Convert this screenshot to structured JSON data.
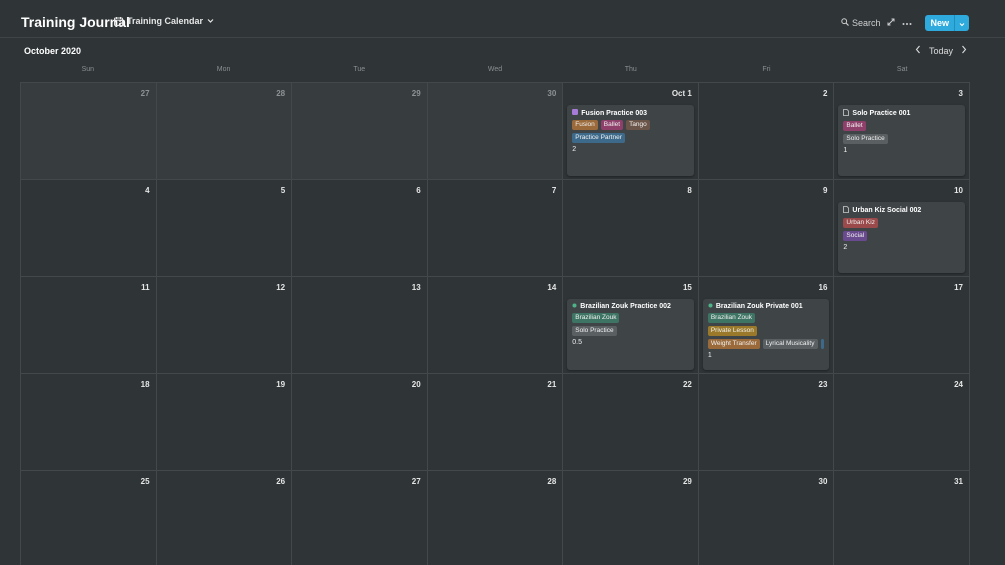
{
  "header": {
    "title": "Training Journal",
    "view_name": "Training Calendar",
    "search_label": "Search",
    "new_label": "New"
  },
  "calendar": {
    "month_label": "October 2020",
    "today_label": "Today",
    "weekdays": [
      "Sun",
      "Mon",
      "Tue",
      "Wed",
      "Thu",
      "Fri",
      "Sat"
    ],
    "weeks": [
      [
        "27",
        "28",
        "29",
        "30",
        "Oct 1",
        "2",
        "3"
      ],
      [
        "4",
        "5",
        "6",
        "7",
        "8",
        "9",
        "10"
      ],
      [
        "11",
        "12",
        "13",
        "14",
        "15",
        "16",
        "17"
      ],
      [
        "18",
        "19",
        "20",
        "21",
        "22",
        "23",
        "24"
      ],
      [
        "25",
        "26",
        "27",
        "28",
        "29",
        "30",
        "31"
      ]
    ]
  },
  "colors": {
    "accent": "#2eaadc",
    "background": "#2f3437",
    "tag_orange": "#9a6a3a",
    "tag_pink": "#8e3f6a",
    "tag_brown": "#6b5548",
    "tag_blue": "#3d6a8a",
    "tag_gray": "#5a5f62",
    "tag_red": "#9a4a4a",
    "tag_purple": "#6a4a8e",
    "tag_green": "#3e7463",
    "tag_yellow": "#9a7a2a"
  },
  "events": [
    {
      "title": "Fusion Practice 003",
      "icon": "purple-square-icon",
      "tag_rows": [
        [
          {
            "label": "Fusion",
            "color": "#9a6a3a"
          },
          {
            "label": "Ballet",
            "color": "#8e3f6a"
          },
          {
            "label": "Tango",
            "color": "#6b5548"
          }
        ],
        [
          {
            "label": "Practice Partner",
            "color": "#3d6a8a"
          }
        ]
      ],
      "value": "2"
    },
    {
      "title": "Solo Practice 001",
      "icon": "page-icon",
      "tag_rows": [
        [
          {
            "label": "Ballet",
            "color": "#8e3f6a"
          }
        ],
        [
          {
            "label": "Solo Practice",
            "color": "#5a5f62"
          }
        ]
      ],
      "value": "1"
    },
    {
      "title": "Urban Kiz Social 002",
      "icon": "page-icon",
      "tag_rows": [
        [
          {
            "label": "Urban Kiz",
            "color": "#9a4a4a"
          }
        ],
        [
          {
            "label": "Social",
            "color": "#6a4a8e"
          }
        ]
      ],
      "value": "2"
    },
    {
      "title": "Brazilian Zouk Practice 002",
      "icon": "green-dot-icon",
      "tag_rows": [
        [
          {
            "label": "Brazilian Zouk",
            "color": "#3e7463"
          }
        ],
        [
          {
            "label": "Solo Practice",
            "color": "#5a5f62"
          }
        ]
      ],
      "value": "0.5"
    },
    {
      "title": "Brazilian Zouk Private 001",
      "icon": "green-dot-icon",
      "tag_rows": [
        [
          {
            "label": "Brazilian Zouk",
            "color": "#3e7463"
          }
        ],
        [
          {
            "label": "Private Lesson",
            "color": "#9a7a2a"
          }
        ],
        [
          {
            "label": "Weight Transfer",
            "color": "#9a6a3a"
          },
          {
            "label": "Lyrical Musicality",
            "color": "#5a5f62"
          },
          {
            "label": "",
            "color": "#3d6a8a"
          }
        ]
      ],
      "value": "1"
    }
  ]
}
